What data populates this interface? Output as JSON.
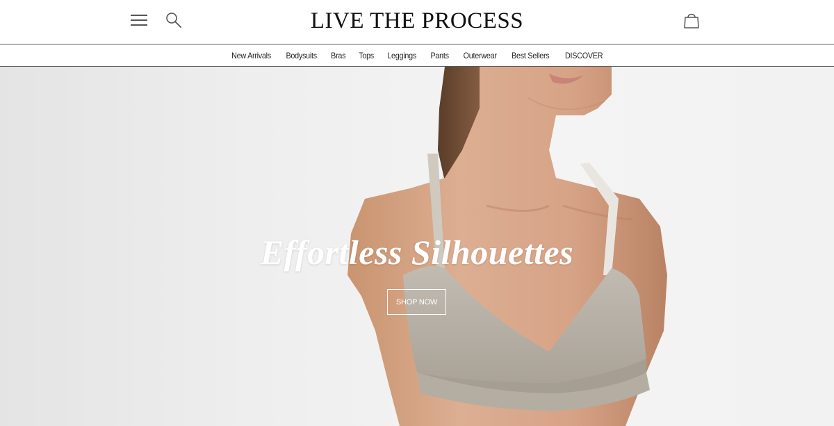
{
  "header": {
    "logo_text": "LIVE THE PROCESS",
    "menu_icon": "hamburger-menu-icon",
    "search_icon": "search-icon",
    "cart_icon": "shopping-bag-icon"
  },
  "nav": {
    "items": [
      {
        "label": "New Arrivals"
      },
      {
        "label": "Bodysuits"
      },
      {
        "label": "Bras"
      },
      {
        "label": "Tops"
      },
      {
        "label": "Leggings"
      },
      {
        "label": "Pants"
      },
      {
        "label": "Outerwear"
      },
      {
        "label": "Best Sellers"
      },
      {
        "label": "DISCOVER"
      }
    ]
  },
  "hero": {
    "title": "Effortless Silhouettes",
    "cta_label": "SHOP NOW",
    "image_subject": "model-wearing-taupe-sports-bra"
  },
  "colors": {
    "background": "#ffffff",
    "border": "#5a5a5a",
    "hero_bg": "#eeeeee",
    "bra": "#b8b1a7",
    "skin": "#d6a88c",
    "hero_text": "#ffffff"
  }
}
